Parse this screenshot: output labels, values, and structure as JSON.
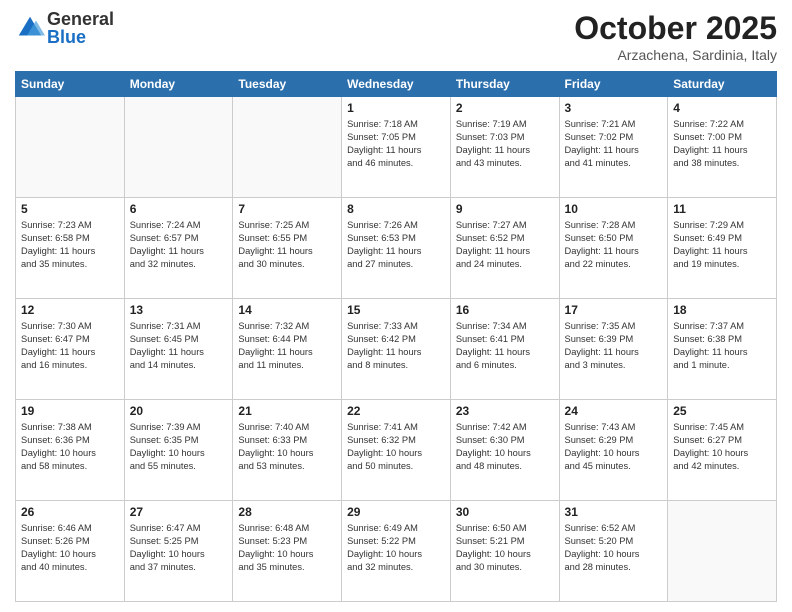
{
  "logo": {
    "general": "General",
    "blue": "Blue"
  },
  "header": {
    "month": "October 2025",
    "location": "Arzachena, Sardinia, Italy"
  },
  "weekdays": [
    "Sunday",
    "Monday",
    "Tuesday",
    "Wednesday",
    "Thursday",
    "Friday",
    "Saturday"
  ],
  "weeks": [
    [
      {
        "day": "",
        "info": ""
      },
      {
        "day": "",
        "info": ""
      },
      {
        "day": "",
        "info": ""
      },
      {
        "day": "1",
        "info": "Sunrise: 7:18 AM\nSunset: 7:05 PM\nDaylight: 11 hours\nand 46 minutes."
      },
      {
        "day": "2",
        "info": "Sunrise: 7:19 AM\nSunset: 7:03 PM\nDaylight: 11 hours\nand 43 minutes."
      },
      {
        "day": "3",
        "info": "Sunrise: 7:21 AM\nSunset: 7:02 PM\nDaylight: 11 hours\nand 41 minutes."
      },
      {
        "day": "4",
        "info": "Sunrise: 7:22 AM\nSunset: 7:00 PM\nDaylight: 11 hours\nand 38 minutes."
      }
    ],
    [
      {
        "day": "5",
        "info": "Sunrise: 7:23 AM\nSunset: 6:58 PM\nDaylight: 11 hours\nand 35 minutes."
      },
      {
        "day": "6",
        "info": "Sunrise: 7:24 AM\nSunset: 6:57 PM\nDaylight: 11 hours\nand 32 minutes."
      },
      {
        "day": "7",
        "info": "Sunrise: 7:25 AM\nSunset: 6:55 PM\nDaylight: 11 hours\nand 30 minutes."
      },
      {
        "day": "8",
        "info": "Sunrise: 7:26 AM\nSunset: 6:53 PM\nDaylight: 11 hours\nand 27 minutes."
      },
      {
        "day": "9",
        "info": "Sunrise: 7:27 AM\nSunset: 6:52 PM\nDaylight: 11 hours\nand 24 minutes."
      },
      {
        "day": "10",
        "info": "Sunrise: 7:28 AM\nSunset: 6:50 PM\nDaylight: 11 hours\nand 22 minutes."
      },
      {
        "day": "11",
        "info": "Sunrise: 7:29 AM\nSunset: 6:49 PM\nDaylight: 11 hours\nand 19 minutes."
      }
    ],
    [
      {
        "day": "12",
        "info": "Sunrise: 7:30 AM\nSunset: 6:47 PM\nDaylight: 11 hours\nand 16 minutes."
      },
      {
        "day": "13",
        "info": "Sunrise: 7:31 AM\nSunset: 6:45 PM\nDaylight: 11 hours\nand 14 minutes."
      },
      {
        "day": "14",
        "info": "Sunrise: 7:32 AM\nSunset: 6:44 PM\nDaylight: 11 hours\nand 11 minutes."
      },
      {
        "day": "15",
        "info": "Sunrise: 7:33 AM\nSunset: 6:42 PM\nDaylight: 11 hours\nand 8 minutes."
      },
      {
        "day": "16",
        "info": "Sunrise: 7:34 AM\nSunset: 6:41 PM\nDaylight: 11 hours\nand 6 minutes."
      },
      {
        "day": "17",
        "info": "Sunrise: 7:35 AM\nSunset: 6:39 PM\nDaylight: 11 hours\nand 3 minutes."
      },
      {
        "day": "18",
        "info": "Sunrise: 7:37 AM\nSunset: 6:38 PM\nDaylight: 11 hours\nand 1 minute."
      }
    ],
    [
      {
        "day": "19",
        "info": "Sunrise: 7:38 AM\nSunset: 6:36 PM\nDaylight: 10 hours\nand 58 minutes."
      },
      {
        "day": "20",
        "info": "Sunrise: 7:39 AM\nSunset: 6:35 PM\nDaylight: 10 hours\nand 55 minutes."
      },
      {
        "day": "21",
        "info": "Sunrise: 7:40 AM\nSunset: 6:33 PM\nDaylight: 10 hours\nand 53 minutes."
      },
      {
        "day": "22",
        "info": "Sunrise: 7:41 AM\nSunset: 6:32 PM\nDaylight: 10 hours\nand 50 minutes."
      },
      {
        "day": "23",
        "info": "Sunrise: 7:42 AM\nSunset: 6:30 PM\nDaylight: 10 hours\nand 48 minutes."
      },
      {
        "day": "24",
        "info": "Sunrise: 7:43 AM\nSunset: 6:29 PM\nDaylight: 10 hours\nand 45 minutes."
      },
      {
        "day": "25",
        "info": "Sunrise: 7:45 AM\nSunset: 6:27 PM\nDaylight: 10 hours\nand 42 minutes."
      }
    ],
    [
      {
        "day": "26",
        "info": "Sunrise: 6:46 AM\nSunset: 5:26 PM\nDaylight: 10 hours\nand 40 minutes."
      },
      {
        "day": "27",
        "info": "Sunrise: 6:47 AM\nSunset: 5:25 PM\nDaylight: 10 hours\nand 37 minutes."
      },
      {
        "day": "28",
        "info": "Sunrise: 6:48 AM\nSunset: 5:23 PM\nDaylight: 10 hours\nand 35 minutes."
      },
      {
        "day": "29",
        "info": "Sunrise: 6:49 AM\nSunset: 5:22 PM\nDaylight: 10 hours\nand 32 minutes."
      },
      {
        "day": "30",
        "info": "Sunrise: 6:50 AM\nSunset: 5:21 PM\nDaylight: 10 hours\nand 30 minutes."
      },
      {
        "day": "31",
        "info": "Sunrise: 6:52 AM\nSunset: 5:20 PM\nDaylight: 10 hours\nand 28 minutes."
      },
      {
        "day": "",
        "info": ""
      }
    ]
  ]
}
